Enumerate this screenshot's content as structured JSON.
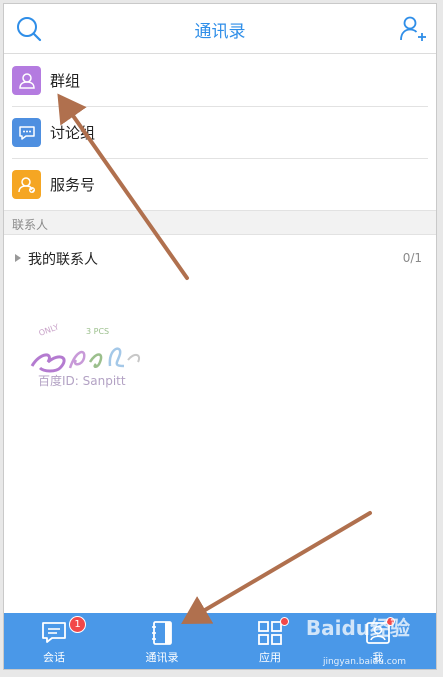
{
  "header": {
    "title": "通讯录",
    "search_icon": "search-icon",
    "add_contact_icon": "add-contact-icon"
  },
  "list": {
    "items": [
      {
        "label": "群组",
        "icon": "group-icon",
        "color": "#b47be0"
      },
      {
        "label": "讨论组",
        "icon": "chat-bubble-icon",
        "color": "#4e8fe0"
      },
      {
        "label": "服务号",
        "icon": "service-icon",
        "color": "#f5a623"
      }
    ]
  },
  "section": {
    "title": "联系人"
  },
  "contacts": {
    "label": "我的联系人",
    "count": "0/1"
  },
  "watermark": {
    "text": "百度ID: Sanpitt"
  },
  "tabbar": {
    "tabs": [
      {
        "label": "会话",
        "icon": "message-icon",
        "badge": "1"
      },
      {
        "label": "通讯录",
        "icon": "contacts-book-icon"
      },
      {
        "label": "应用",
        "icon": "apps-grid-icon"
      },
      {
        "label": "我",
        "icon": "profile-icon"
      }
    ],
    "brand_watermark": "Baidu经验",
    "brand_url": "jingyan.baidu.com"
  },
  "colors": {
    "accent": "#2f8ee8",
    "tabbar": "#4a98e8",
    "badge": "#f2484a",
    "annotation_arrow": "#b0704e"
  }
}
